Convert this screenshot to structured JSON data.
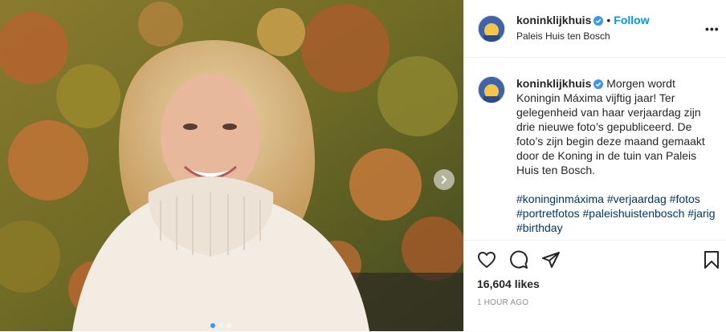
{
  "post": {
    "username": "koninklijkhuis",
    "follow_label": "Follow",
    "separator": "•",
    "location": "Paleis Huis ten Bosch",
    "caption": "Morgen wordt Koningin Máxima vijftig jaar! Ter gelegenheid van haar verjaardag zijn drie nieuwe foto’s gepubliceerd. De foto’s zijn begin deze maand gemaakt door de Koning in de tuin van Paleis Huis ten Bosch.",
    "hashtags": [
      "#koninginmáxima",
      "#verjaardag",
      "#fotos",
      "#portretfotos",
      "#paleishuistenbosch",
      "#jarig",
      "#birthday"
    ],
    "likes": "16,604 likes",
    "time": "1 HOUR AGO",
    "more_label": "•••",
    "carousel": {
      "slide": 1,
      "total": 3
    }
  },
  "colors": {
    "accent": "#0095f6",
    "active_dot": "#3897f0",
    "verified": "#3897f0",
    "text": "#262626",
    "muted": "#8e8e8e"
  },
  "icons": [
    "verified-badge-icon",
    "heart-icon",
    "comment-icon",
    "share-icon",
    "bookmark-icon",
    "chevron-right-icon",
    "more-options-icon"
  ]
}
